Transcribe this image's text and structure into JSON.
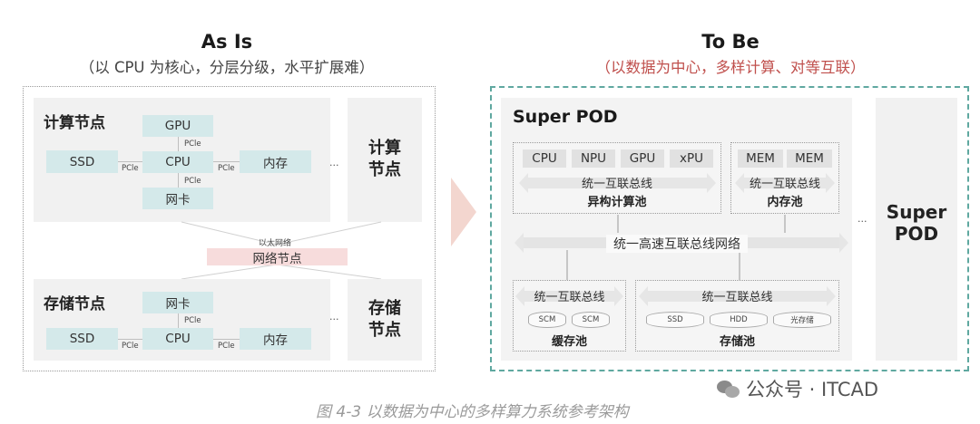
{
  "left": {
    "title": "As Is",
    "subtitle": "（以 CPU 为核心，分层分级，水平扩展难）",
    "compute_node": {
      "label": "计算节点",
      "gpu": "GPU",
      "ssd": "SSD",
      "cpu": "CPU",
      "memory": "内存",
      "nic": "网卡",
      "pcie": "PCle"
    },
    "compute_side_label": "计算\n节点",
    "network": {
      "small": "以太网络",
      "box": "网络节点"
    },
    "storage_node": {
      "label": "存储节点",
      "nic": "网卡",
      "ssd": "SSD",
      "cpu": "CPU",
      "memory": "内存",
      "pcie": "PCle"
    },
    "storage_side_label": "存储\n节点",
    "ellipsis": "···"
  },
  "right": {
    "title": "To Be",
    "subtitle": "（以数据为中心，多样计算、对等互联）",
    "pod_title": "Super POD",
    "hetero": {
      "chips": [
        "CPU",
        "NPU",
        "GPU",
        "xPU"
      ],
      "bus": "统一互联总线",
      "pool": "异构计算池"
    },
    "memory_pool": {
      "chips": [
        "MEM",
        "MEM"
      ],
      "bus": "统一互联总线",
      "pool": "内存池"
    },
    "network_bus": "统一高速互联总线网络",
    "cache_pool": {
      "bus": "统一互联总线",
      "items": [
        "SCM",
        "SCM"
      ],
      "pool": "缓存池"
    },
    "storage_pool": {
      "bus": "统一互联总线",
      "items": [
        "SSD",
        "HDD",
        "光存储"
      ],
      "pool": "存储池"
    },
    "ellipsis": "···",
    "side_label": "Super\nPOD"
  },
  "caption": "图 4-3 以数据为中心的多样算力系统参考架构",
  "watermark": "公众号 · ITCAD"
}
